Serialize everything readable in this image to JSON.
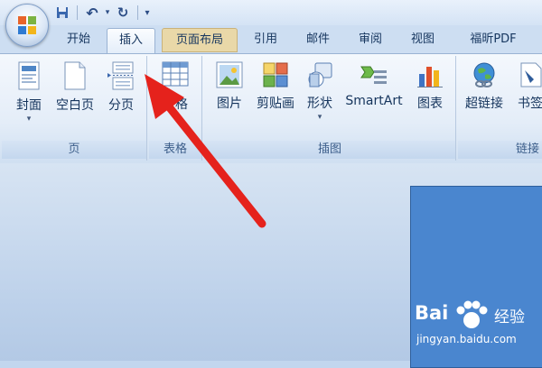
{
  "quick_access": {
    "items": [
      {
        "name": "save-icon",
        "glyph": ""
      },
      {
        "name": "undo-icon",
        "glyph": "↶"
      },
      {
        "name": "undo-dropdown-icon",
        "glyph": "▾"
      },
      {
        "name": "redo-icon",
        "glyph": "↻"
      },
      {
        "name": "customize-qat-icon",
        "glyph": "▾"
      }
    ]
  },
  "tabs": [
    {
      "label": "开始"
    },
    {
      "label": "插入",
      "active": true
    },
    {
      "label": "页面布局"
    },
    {
      "label": "引用"
    },
    {
      "label": "邮件"
    },
    {
      "label": "审阅"
    },
    {
      "label": "视图"
    },
    {
      "label": "福昕PDF"
    }
  ],
  "ribbon": {
    "pages_group": {
      "label": "页",
      "cover": "封面",
      "blank_page": "空白页",
      "page_break": "分页"
    },
    "tables_group": {
      "label": "表格",
      "table": "表格"
    },
    "illustrations_group": {
      "label": "插图",
      "picture": "图片",
      "clipart": "剪贴画",
      "shapes": "形状",
      "smartart": "SmartArt",
      "chart": "图表"
    },
    "links_group": {
      "label": "链接",
      "hyperlink": "超链接",
      "bookmark": "书签"
    }
  },
  "annotation": {
    "color": "#e5221c"
  },
  "watermark": {
    "brand_left": "Bai",
    "brand_right": "经验",
    "url": "jingyan.baidu.com"
  }
}
